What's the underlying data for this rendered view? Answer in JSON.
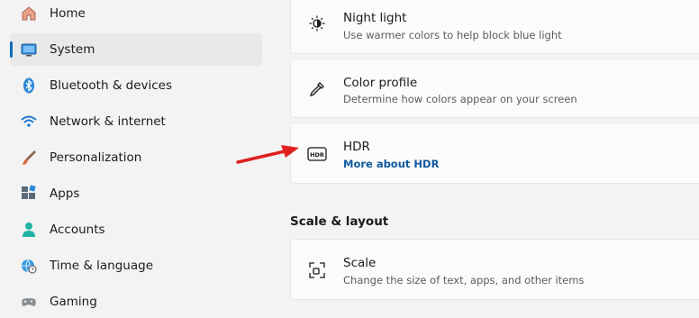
{
  "sidebar": {
    "items": [
      {
        "label": "Home",
        "icon": "home-icon"
      },
      {
        "label": "System",
        "icon": "system-icon",
        "selected": true
      },
      {
        "label": "Bluetooth & devices",
        "icon": "bluetooth-icon"
      },
      {
        "label": "Network & internet",
        "icon": "wifi-icon"
      },
      {
        "label": "Personalization",
        "icon": "brush-icon"
      },
      {
        "label": "Apps",
        "icon": "apps-icon"
      },
      {
        "label": "Accounts",
        "icon": "accounts-icon"
      },
      {
        "label": "Time & language",
        "icon": "globe-clock-icon"
      },
      {
        "label": "Gaming",
        "icon": "gamepad-icon"
      }
    ]
  },
  "main": {
    "night_light": {
      "title": "Night light",
      "description": "Use warmer colors to help block blue light",
      "icon": "night-light-icon"
    },
    "color_profile": {
      "title": "Color profile",
      "description": "Determine how colors appear on your screen",
      "icon": "eyedropper-icon"
    },
    "hdr": {
      "title": "HDR",
      "link": "More about HDR",
      "icon": "hdr-icon"
    },
    "scale_section_title": "Scale & layout",
    "scale": {
      "title": "Scale",
      "description": "Change the size of text, apps, and other items",
      "icon": "scale-icon"
    }
  },
  "colors": {
    "accent": "#0f6cbd",
    "link": "#0f5a9e",
    "annotation_arrow": "#e02020",
    "background": "#f3f3f3",
    "card": "#fbfbfb"
  }
}
